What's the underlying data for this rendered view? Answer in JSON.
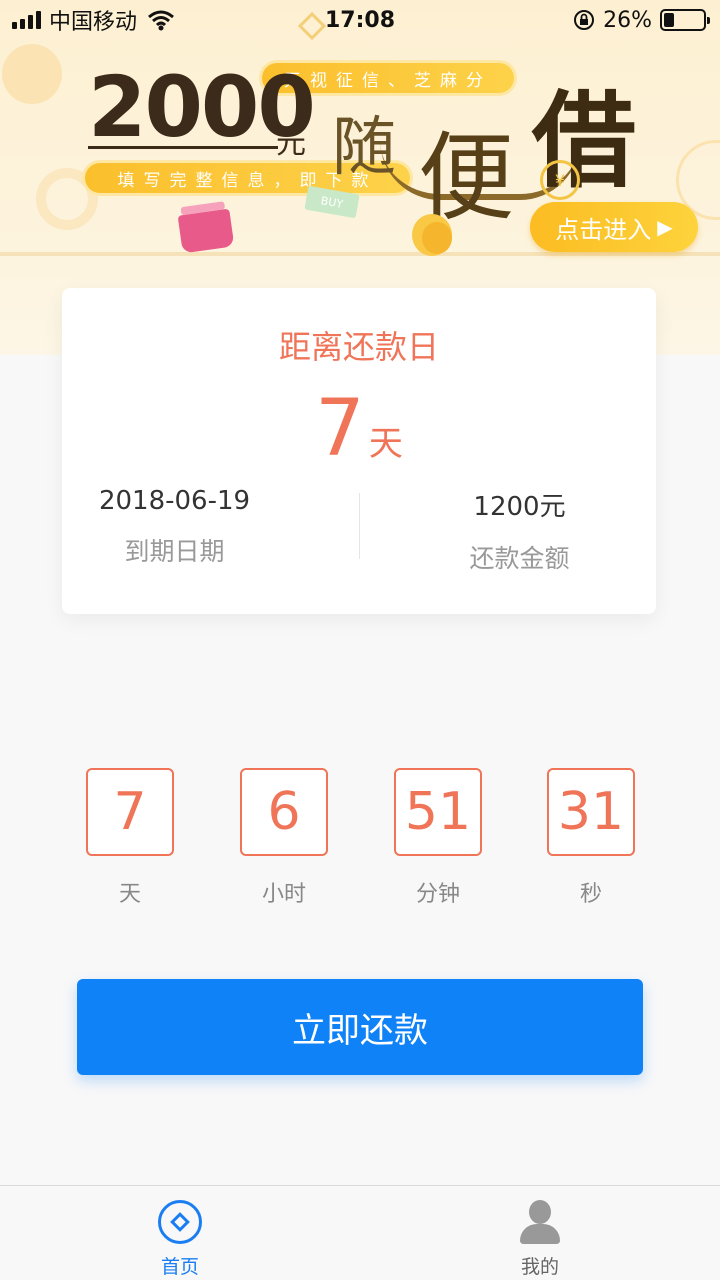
{
  "status_bar": {
    "carrier": "中国移动",
    "time": "17:08",
    "battery_percent": "26%",
    "battery_level": 0.26,
    "icons": [
      "signal-icon",
      "wifi-icon",
      "orientation-lock-icon",
      "battery-icon"
    ]
  },
  "banner": {
    "amount": "2000",
    "amount_unit": "元",
    "pill_top": "无视征信、芝麻分",
    "pill_bottom": "填写完整信息，即下款",
    "slogan_1": "随",
    "slogan_2": "便",
    "slogan_3": "借",
    "buy_tag": "BUY",
    "yuan_symbol": "¥",
    "enter_label": "点击进入",
    "enter_arrow": "▶"
  },
  "card": {
    "title": "距离还款日",
    "days_value": "7",
    "days_unit": "天",
    "due_date_value": "2018-06-19",
    "due_date_label": "到期日期",
    "amount_value": "1200元",
    "amount_label": "还款金额"
  },
  "countdown": {
    "days": {
      "value": "7",
      "label": "天"
    },
    "hours": {
      "value": "6",
      "label": "小时"
    },
    "minutes": {
      "value": "51",
      "label": "分钟"
    },
    "seconds": {
      "value": "31",
      "label": "秒"
    }
  },
  "repay_button": "立即还款",
  "tab_bar": {
    "home_label": "首页",
    "mine_label": "我的"
  },
  "colors": {
    "accent_orange": "#f07458",
    "primary_blue": "#0f82f7",
    "banner_yellow": "#fcbc22"
  }
}
